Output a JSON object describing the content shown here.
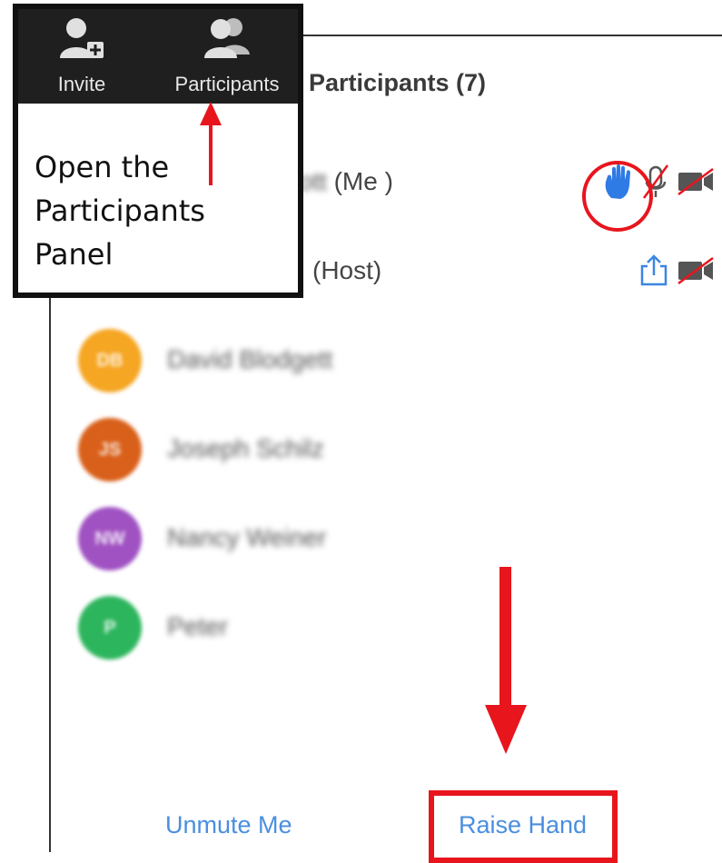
{
  "toolbar": {
    "invite_label": "Invite",
    "participants_label": "Participants",
    "icons": [
      "add-user-icon",
      "participants-icon"
    ]
  },
  "callout": {
    "lines": [
      "Open the",
      "Participants",
      "Panel"
    ]
  },
  "panel": {
    "title": "Participants (7)",
    "participants": [
      {
        "name": "(Me )",
        "blurred_name": "Scott",
        "status_icons": [
          "raised-hand-icon",
          "muted-mic-icon",
          "video-off-icon"
        ]
      },
      {
        "name": "(Host)",
        "blurred_name": "Teacher",
        "status_icons": [
          "share-screen-icon",
          "video-off-icon"
        ]
      },
      {
        "name": "David Blodgett",
        "initials": "DB",
        "avatar_color": "#f5a623"
      },
      {
        "name": "Joseph Schilz",
        "initials": "JS",
        "avatar_color": "#d9601a"
      },
      {
        "name": "Nancy Weiner",
        "initials": "NW",
        "avatar_color": "#a052c2"
      },
      {
        "name": "Peter",
        "initials": "P",
        "avatar_color": "#2db55d"
      }
    ]
  },
  "footer": {
    "unmute_label": "Unmute Me",
    "raise_hand_label": "Raise Hand"
  },
  "colors": {
    "accent_blue": "#4a8ee0",
    "highlight_red": "#e8151d",
    "toolbar_bg": "#1f1f1f"
  }
}
